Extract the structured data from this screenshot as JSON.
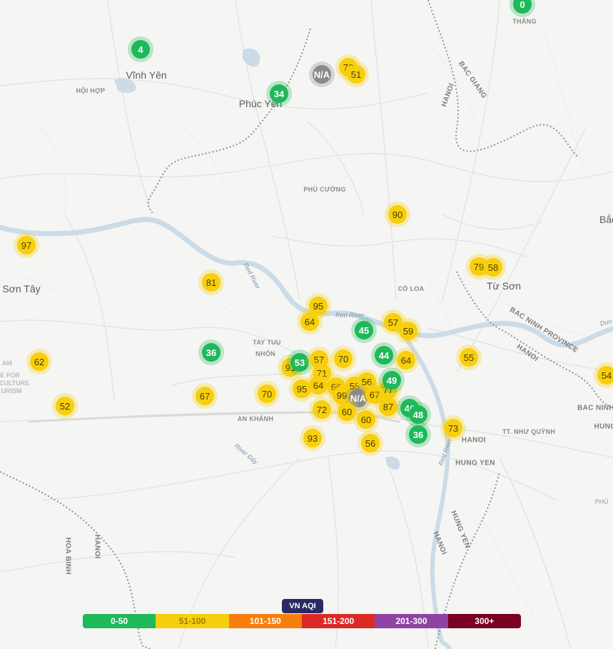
{
  "legend": {
    "title": "VN AQI",
    "bands": [
      {
        "label": "0-50",
        "color": "#1fb85a",
        "text": "#ffffff"
      },
      {
        "label": "51-100",
        "color": "#f7cf0d",
        "text": "#9a7d00"
      },
      {
        "label": "101-150",
        "color": "#f77f0d",
        "text": "#ffffff"
      },
      {
        "label": "151-200",
        "color": "#db2a25",
        "text": "#ffffff"
      },
      {
        "label": "201-300",
        "color": "#8e44a3",
        "text": "#ffffff"
      },
      {
        "label": "300+",
        "color": "#7a0022",
        "text": "#ffffff"
      }
    ]
  },
  "places": {
    "vinh_yen": "Vĩnh Yên",
    "phuc_yen": "Phúc Yên",
    "son_tay": "Sơn Tây",
    "tu_son": "Từ Sơn",
    "hoi_hop": "HỘI HỢP",
    "phu_cuong": "PHÙ CƯỜNG",
    "co_loa": "CỔ LOA",
    "tay_tuu": "TAY TUU",
    "nhon": "NHỔN",
    "an_khanh": "AN KHÁNH",
    "thang": "THẮNG",
    "bac_giang": "BAC GIANG",
    "hanoi": "HANOI",
    "bac_ninh_province": "BAC NINH PROVINCE",
    "bac_ninh": "BAC NINH",
    "hung": "HUNG",
    "hung_yen": "HUNG YEN",
    "tt_nhu_quynh": "TT. NHƯ QUỲNH",
    "hoa_binh": "HOA BINH",
    "red_river": "Red River",
    "river_day": "River Đáy",
    "bac_edge": "Bắc",
    "phu_edge": "PHỦ",
    "duo_edge": "Duo",
    "am_frag": "AM",
    "e_for_frag": "E FOR",
    "culture_frag": "CULTURE",
    "urism_frag": "URISM"
  },
  "aqi_markers": [
    {
      "value": "0",
      "level": "good"
    },
    {
      "value": "4",
      "level": "good"
    },
    {
      "value": "34",
      "level": "good"
    },
    {
      "value": "N/A",
      "level": "na"
    },
    {
      "value": "72",
      "level": "moderate"
    },
    {
      "value": "51",
      "level": "moderate"
    },
    {
      "value": "90",
      "level": "moderate"
    },
    {
      "value": "97",
      "level": "moderate"
    },
    {
      "value": "81",
      "level": "moderate"
    },
    {
      "value": "79",
      "level": "moderate"
    },
    {
      "value": "58",
      "level": "moderate"
    },
    {
      "value": "95",
      "level": "moderate"
    },
    {
      "value": "64",
      "level": "moderate"
    },
    {
      "value": "57",
      "level": "moderate"
    },
    {
      "value": "59",
      "level": "moderate"
    },
    {
      "value": "45",
      "level": "good"
    },
    {
      "value": "36",
      "level": "good"
    },
    {
      "value": "62",
      "level": "moderate"
    },
    {
      "value": "55",
      "level": "moderate"
    },
    {
      "value": "54",
      "level": "moderate"
    },
    {
      "value": "67",
      "level": "moderate"
    },
    {
      "value": "70",
      "level": "moderate"
    },
    {
      "value": "52",
      "level": "moderate"
    },
    {
      "value": "91",
      "level": "moderate"
    },
    {
      "value": "53",
      "level": "good"
    },
    {
      "value": "57",
      "level": "moderate"
    },
    {
      "value": "70",
      "level": "moderate"
    },
    {
      "value": "71",
      "level": "moderate"
    },
    {
      "value": "95",
      "level": "moderate"
    },
    {
      "value": "64",
      "level": "moderate"
    },
    {
      "value": "66",
      "level": "moderate"
    },
    {
      "value": "99",
      "level": "moderate"
    },
    {
      "value": "55",
      "level": "moderate"
    },
    {
      "value": "56",
      "level": "moderate"
    },
    {
      "value": "N/A",
      "level": "na"
    },
    {
      "value": "67",
      "level": "moderate"
    },
    {
      "value": "77",
      "level": "moderate"
    },
    {
      "value": "44",
      "level": "good"
    },
    {
      "value": "64",
      "level": "moderate"
    },
    {
      "value": "49",
      "level": "good"
    },
    {
      "value": "72",
      "level": "moderate"
    },
    {
      "value": "60",
      "level": "moderate"
    },
    {
      "value": "60",
      "level": "moderate"
    },
    {
      "value": "87",
      "level": "moderate"
    },
    {
      "value": "46",
      "level": "good"
    },
    {
      "value": "48",
      "level": "good"
    },
    {
      "value": "36",
      "level": "good"
    },
    {
      "value": "73",
      "level": "moderate"
    },
    {
      "value": "93",
      "level": "moderate"
    },
    {
      "value": "56",
      "level": "moderate"
    }
  ]
}
